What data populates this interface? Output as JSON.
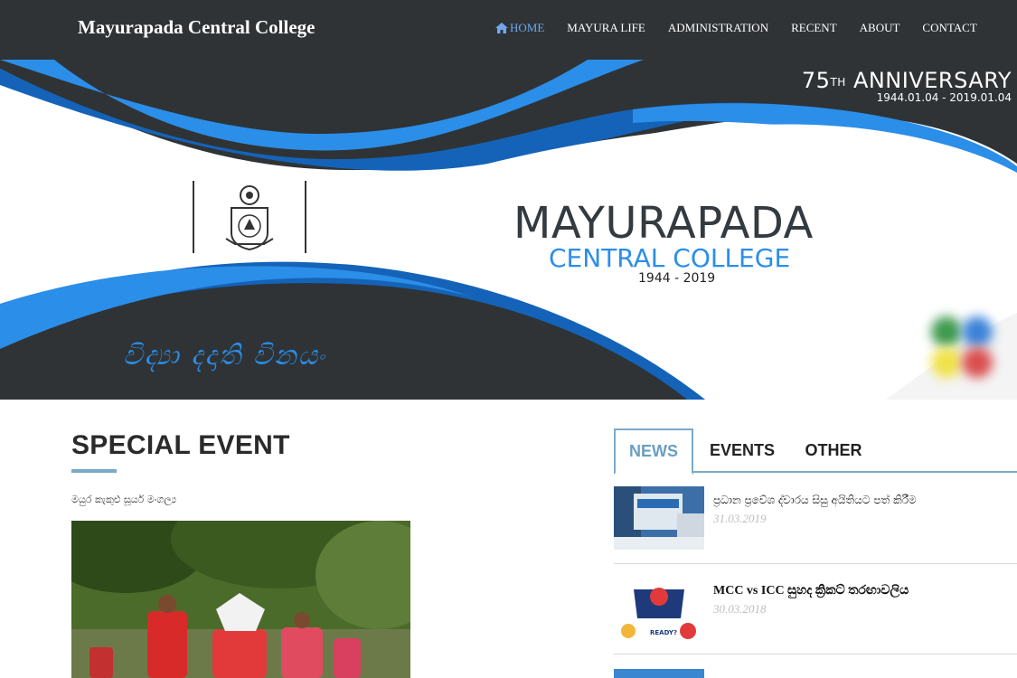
{
  "header": {
    "brand": "Mayurapada Central College",
    "nav": [
      {
        "label": "HOME",
        "active": true
      },
      {
        "label": "MAYURA LIFE"
      },
      {
        "label": "ADMINISTRATION"
      },
      {
        "label": "RECENT"
      },
      {
        "label": "ABOUT"
      },
      {
        "label": "CONTACT"
      }
    ]
  },
  "banner": {
    "anniversary_number": "75",
    "anniversary_suffix": "TH",
    "anniversary_word": "ANNIVERSARY",
    "anniversary_dates": "1944.01.04 - 2019.01.04",
    "school_name": "MAYURAPADA",
    "school_sub": "CENTRAL COLLEGE",
    "school_years": "1944 - 2019",
    "motto": "විද්‍යා දදාති විනයං"
  },
  "special_event": {
    "title": "SPECIAL EVENT",
    "caption": "මයුර කැකුළු සූර්ය මංගල්‍ය"
  },
  "tabs": [
    {
      "label": "NEWS",
      "active": true
    },
    {
      "label": "EVENTS"
    },
    {
      "label": "OTHER"
    }
  ],
  "news": [
    {
      "title": "ප්‍රධාන ප්‍රවේශ ද්වාරය සිසු අයිතියට පත් කිරීම",
      "date": "31.03.2019"
    },
    {
      "title": "MCC vs ICC සුහද ක්‍රිකට් තරඟාවලිය",
      "date": "30.03.2018"
    }
  ],
  "colors": {
    "nav_bg": "#2f3336",
    "accent_blue": "#2b8ee8",
    "tab_accent": "#7aaac9"
  }
}
